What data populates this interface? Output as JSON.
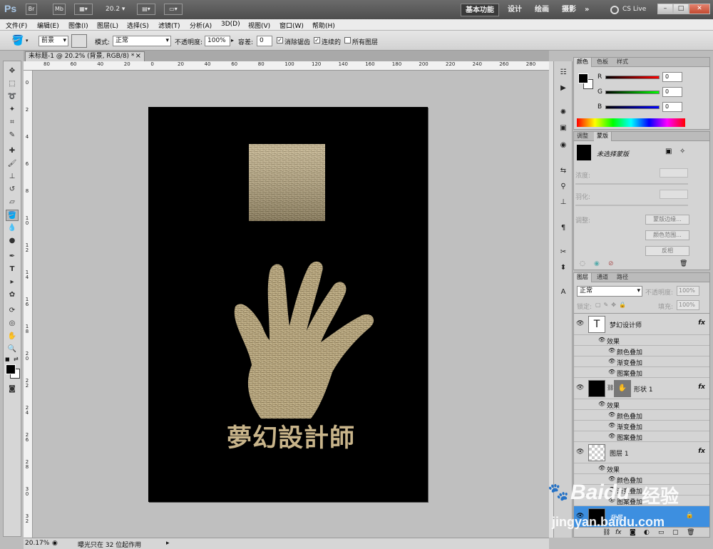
{
  "app": {
    "logo": "Ps"
  },
  "titlebar": {
    "br_label": "Br",
    "mb_label": "Mb",
    "zoom_value": "20.2",
    "workspaces": [
      "基本功能",
      "设计",
      "绘画",
      "摄影"
    ],
    "more": "»",
    "cslive": "CS Live",
    "win_buttons": [
      "–",
      "□",
      "✕"
    ]
  },
  "menu": [
    "文件(F)",
    "编辑(E)",
    "图像(I)",
    "图层(L)",
    "选择(S)",
    "滤镜(T)",
    "分析(A)",
    "3D(D)",
    "视图(V)",
    "窗口(W)",
    "帮助(H)"
  ],
  "options": {
    "fill_source": "前景",
    "mode_label": "模式:",
    "mode_value": "正常",
    "opacity_label": "不透明度:",
    "opacity_value": "100%",
    "tolerance_label": "容差:",
    "tolerance_value": "0",
    "antialias_label": "消除锯齿",
    "antialias_checked": "✓",
    "contiguous_label": "连续的",
    "contiguous_checked": "✓",
    "alllayers_label": "所有图层"
  },
  "document": {
    "tab_title": "未标题-1 @ 20.2% (背景, RGB/8) *",
    "tab_close": "×",
    "brand_text": "夢幻設計師"
  },
  "rulers": {
    "h": [
      "80",
      "60",
      "40",
      "20",
      "0",
      "20",
      "40",
      "60",
      "80",
      "100",
      "120",
      "140",
      "160",
      "180",
      "200",
      "220",
      "240",
      "260",
      "280"
    ],
    "v": [
      "0",
      "2",
      "4",
      "6",
      "8",
      "10",
      "12",
      "14",
      "16",
      "18",
      "20",
      "22",
      "24",
      "26",
      "28",
      "30",
      "32"
    ]
  },
  "status": {
    "zoom": "20.17%",
    "message": "曝光只在 32 位起作用"
  },
  "color_panel": {
    "tabs": [
      "颜色",
      "色板",
      "样式"
    ],
    "channels": [
      {
        "name": "R",
        "value": "0"
      },
      {
        "name": "G",
        "value": "0"
      },
      {
        "name": "B",
        "value": "0"
      }
    ]
  },
  "mask_panel": {
    "tabs": [
      "调整",
      "蒙版"
    ],
    "status": "未选择蒙版",
    "density_label": "浓度:",
    "feather_label": "羽化:",
    "refine_label": "调整:",
    "btn_edge": "蒙版边缘...",
    "btn_range": "颜色范围...",
    "btn_invert": "反相"
  },
  "layers_panel": {
    "tabs": [
      "图层",
      "通道",
      "路径"
    ],
    "blend": "正常",
    "opacity_label": "不透明度:",
    "opacity_value": "100%",
    "lock_label": "锁定:",
    "fill_label": "填充:",
    "fill_value": "100%",
    "fx_label": "fx",
    "effects_label": "效果",
    "text_thumb": "T",
    "layers": [
      {
        "name": "梦幻设计师",
        "effects": [
          "颜色叠加",
          "渐变叠加",
          "图案叠加"
        ]
      },
      {
        "name": "形状 1",
        "effects": [
          "颜色叠加",
          "渐变叠加",
          "图案叠加"
        ]
      },
      {
        "name": "图层 1",
        "effects": [
          "颜色叠加",
          "渐变叠加",
          "图案叠加"
        ]
      },
      {
        "name": "背景"
      }
    ]
  },
  "watermark": {
    "brand": "Baidu",
    "suffix": "经验",
    "url": "jingyan.baidu.com"
  },
  "colors": {
    "accent_selected": "#3d8fe0",
    "gold": "#c8b48a"
  }
}
